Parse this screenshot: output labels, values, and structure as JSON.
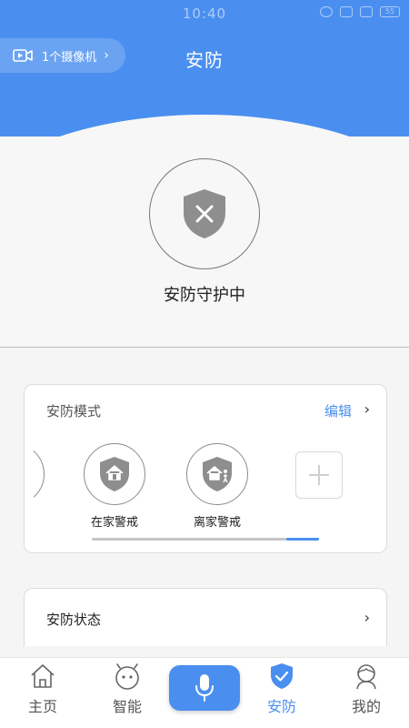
{
  "status_bar": {
    "time": "10:40",
    "battery": "55"
  },
  "header": {
    "camera_pill_label": "1个摄像机",
    "title": "安防"
  },
  "protection": {
    "status_label": "安防守护中"
  },
  "mode_card": {
    "title": "安防模式",
    "edit_label": "编辑",
    "modes": [
      {
        "label": "在家警戒",
        "icon": "home-shield-icon"
      },
      {
        "label": "离家警戒",
        "icon": "away-shield-icon"
      }
    ],
    "scroll_position": 0.86
  },
  "status_card": {
    "title": "安防状态"
  },
  "bottom_nav": {
    "items": [
      {
        "label": "主页",
        "icon": "home-icon"
      },
      {
        "label": "智能",
        "icon": "robot-icon"
      },
      {
        "label": "安防",
        "icon": "shield-check-icon"
      },
      {
        "label": "我的",
        "icon": "user-icon"
      }
    ],
    "active_index": 2
  },
  "colors": {
    "accent": "#4a8ff0",
    "shield_gray": "#8e8e8e",
    "background": "#f7f7f7"
  }
}
